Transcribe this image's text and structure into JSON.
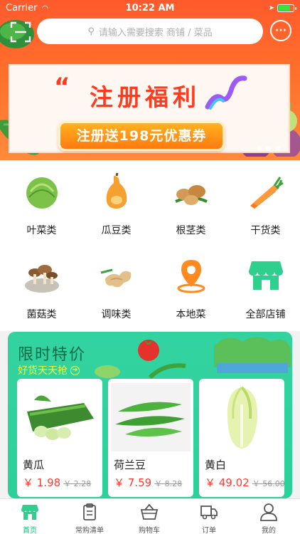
{
  "status_bar": {
    "carrier": "Carrier",
    "time": "10:22 AM"
  },
  "search": {
    "placeholder": "请输入需要搜索 商铺 / 菜品"
  },
  "banner": {
    "quote": "“",
    "title": "注册福利",
    "cta": "注册送198元优惠券",
    "slides": 3,
    "active_slide": 1
  },
  "categories": [
    {
      "label": "叶菜类",
      "icon": "cabbage-icon"
    },
    {
      "label": "瓜豆类",
      "icon": "squash-icon"
    },
    {
      "label": "根茎类",
      "icon": "potato-icon"
    },
    {
      "label": "干货类",
      "icon": "carrot-icon"
    },
    {
      "label": "菌菇类",
      "icon": "mushroom-icon"
    },
    {
      "label": "调味类",
      "icon": "ginger-icon"
    },
    {
      "label": "本地菜",
      "icon": "location-pin-icon"
    },
    {
      "label": "全部店铺",
      "icon": "store-icon"
    }
  ],
  "flash_sale": {
    "title": "限时特价",
    "subtitle": "好货天天抢",
    "products": [
      {
        "name": "黄瓜",
        "price": "￥ 1.98",
        "old_price": "￥ 2.28"
      },
      {
        "name": "荷兰豆",
        "price": "￥ 7.59",
        "old_price": "￥ 8.28"
      },
      {
        "name": "黄白",
        "price": "￥ 49.02",
        "old_price": "￥ 56.00"
      }
    ]
  },
  "tabs": [
    {
      "label": "首页",
      "icon": "store-home-icon",
      "active": true
    },
    {
      "label": "常购清单",
      "icon": "clipboard-icon",
      "active": false
    },
    {
      "label": "购物车",
      "icon": "basket-icon",
      "active": false
    },
    {
      "label": "订单",
      "icon": "truck-icon",
      "active": false
    },
    {
      "label": "我的",
      "icon": "user-icon",
      "active": false
    }
  ],
  "colors": {
    "accent": "#ff5a2c",
    "sale_green": "#2bd199",
    "price_red": "#ff3b30",
    "tab_active": "#1db57d"
  }
}
